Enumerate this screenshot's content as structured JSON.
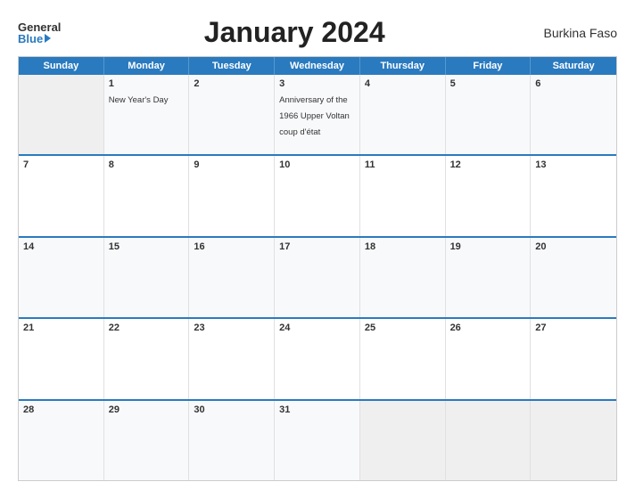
{
  "header": {
    "logo_general": "General",
    "logo_blue": "Blue",
    "title": "January 2024",
    "country": "Burkina Faso"
  },
  "day_headers": [
    "Sunday",
    "Monday",
    "Tuesday",
    "Wednesday",
    "Thursday",
    "Friday",
    "Saturday"
  ],
  "weeks": [
    [
      {
        "day": "",
        "empty": true
      },
      {
        "day": "1",
        "event": "New Year's Day"
      },
      {
        "day": "2",
        "event": ""
      },
      {
        "day": "3",
        "event": "Anniversary of the 1966 Upper Voltan coup d'état"
      },
      {
        "day": "4",
        "event": ""
      },
      {
        "day": "5",
        "event": ""
      },
      {
        "day": "6",
        "event": ""
      }
    ],
    [
      {
        "day": "7",
        "event": ""
      },
      {
        "day": "8",
        "event": ""
      },
      {
        "day": "9",
        "event": ""
      },
      {
        "day": "10",
        "event": ""
      },
      {
        "day": "11",
        "event": ""
      },
      {
        "day": "12",
        "event": ""
      },
      {
        "day": "13",
        "event": ""
      }
    ],
    [
      {
        "day": "14",
        "event": ""
      },
      {
        "day": "15",
        "event": ""
      },
      {
        "day": "16",
        "event": ""
      },
      {
        "day": "17",
        "event": ""
      },
      {
        "day": "18",
        "event": ""
      },
      {
        "day": "19",
        "event": ""
      },
      {
        "day": "20",
        "event": ""
      }
    ],
    [
      {
        "day": "21",
        "event": ""
      },
      {
        "day": "22",
        "event": ""
      },
      {
        "day": "23",
        "event": ""
      },
      {
        "day": "24",
        "event": ""
      },
      {
        "day": "25",
        "event": ""
      },
      {
        "day": "26",
        "event": ""
      },
      {
        "day": "27",
        "event": ""
      }
    ],
    [
      {
        "day": "28",
        "event": ""
      },
      {
        "day": "29",
        "event": ""
      },
      {
        "day": "30",
        "event": ""
      },
      {
        "day": "31",
        "event": ""
      },
      {
        "day": "",
        "empty": true
      },
      {
        "day": "",
        "empty": true
      },
      {
        "day": "",
        "empty": true
      }
    ]
  ]
}
